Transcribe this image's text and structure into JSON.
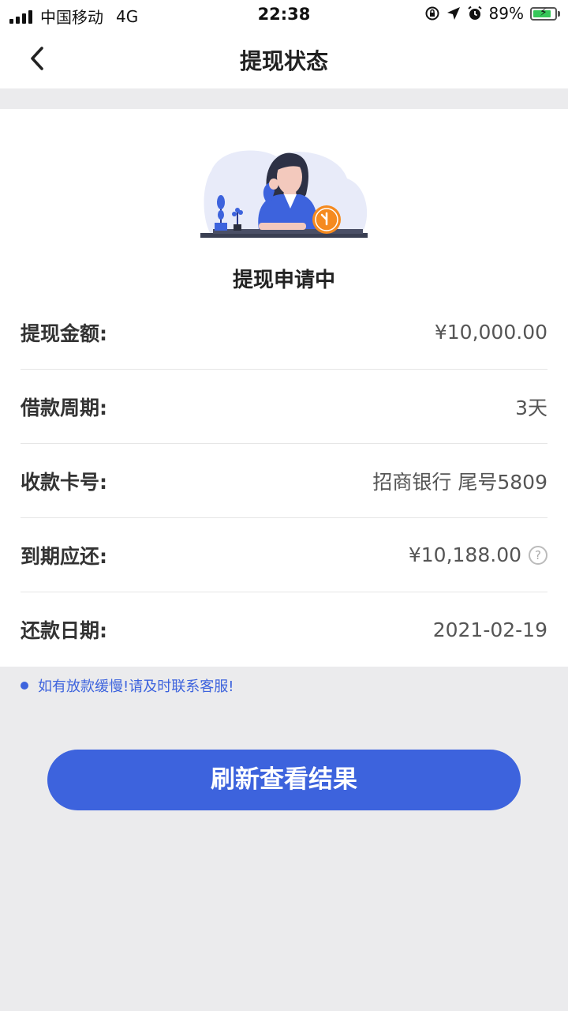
{
  "status_bar": {
    "carrier": "中国移动",
    "network": "4G",
    "time": "22:38",
    "battery": "89%"
  },
  "nav": {
    "title": "提现状态",
    "back_icon": "chevron-left-icon"
  },
  "status": {
    "text": "提现申请中",
    "illustration": "woman-waiting-with-clock-illustration"
  },
  "details": [
    {
      "label": "提现金额:",
      "value": "¥10,000.00"
    },
    {
      "label": "借款周期:",
      "value": "3天"
    },
    {
      "label": "收款卡号:",
      "value": "招商银行 尾号5809"
    },
    {
      "label": "到期应还:",
      "value": "¥10,188.00",
      "help_icon": "question-circle-icon",
      "help_glyph": "?"
    },
    {
      "label": "还款日期:",
      "value": "2021-02-19"
    }
  ],
  "notice": "如有放款缓慢!请及时联系客服!",
  "refresh_button": "刷新查看结果",
  "colors": {
    "accent": "#3d63dd",
    "background": "#ebebed",
    "card": "#ffffff",
    "clock": "#f58a1f"
  }
}
